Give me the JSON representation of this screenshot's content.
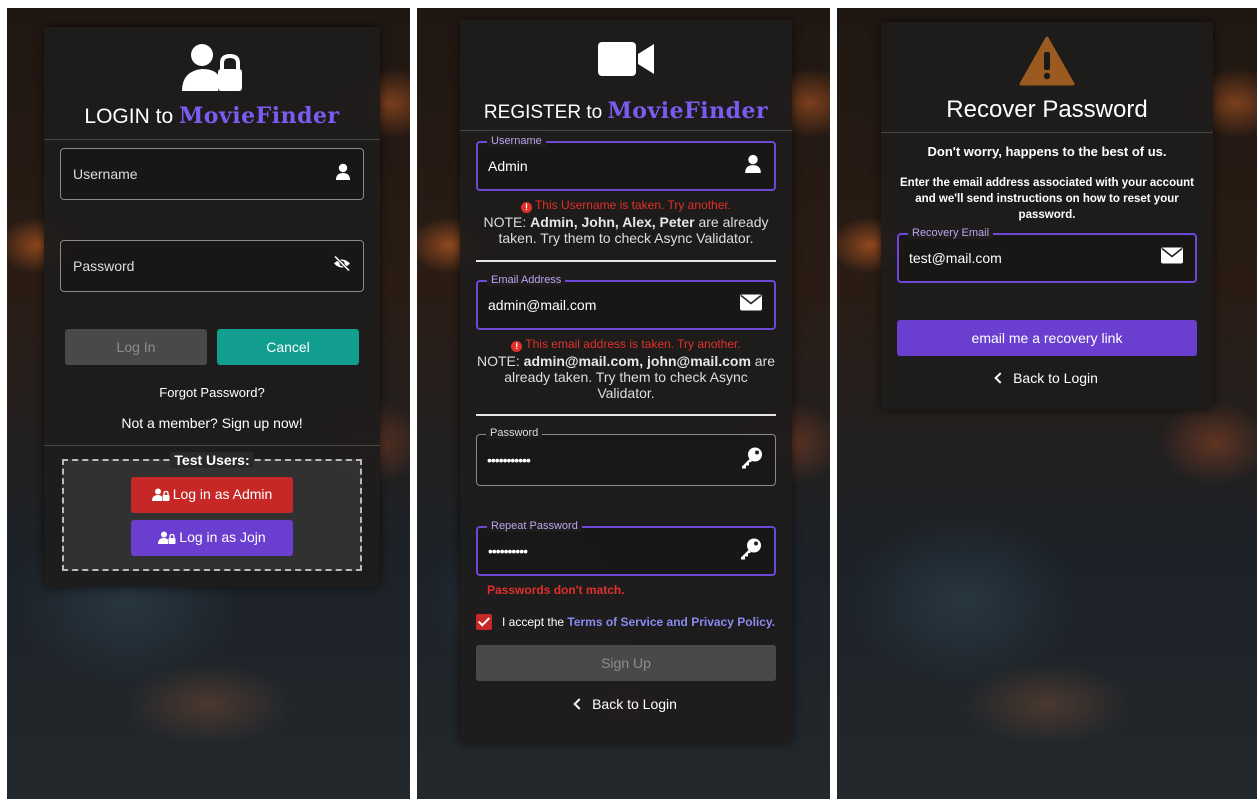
{
  "login": {
    "title_prefix": "LOGIN to ",
    "brand": "MovieFinder",
    "username_placeholder": "Username",
    "password_placeholder": "Password",
    "login_button": "Log In",
    "cancel_button": "Cancel",
    "forgot_password": "Forgot Password?",
    "signup_link": "Not a member? Sign up now!",
    "test_users_label": "Test Users:",
    "admin_button": "Log in as Admin",
    "jojn_button": "Log in as Jojn",
    "colors": {
      "cancel": "#119e8f",
      "admin": "#c62828",
      "jojn": "#6a3fd0",
      "disabled": "#4a4848"
    }
  },
  "register": {
    "title_prefix": "REGISTER to ",
    "brand": "MovieFinder",
    "username_label": "Username",
    "username_value": "Admin",
    "username_error": "This Username is taken. Try another.",
    "username_note_prefix": "NOTE: ",
    "username_note_names": "Admin, John, Alex, Peter",
    "username_note_suffix": " are already taken. Try them to check Async Validator.",
    "email_label": "Email Address",
    "email_value": "admin@mail.com",
    "email_error": "This email address is taken. Try another.",
    "email_note_prefix": "NOTE: ",
    "email_note_emails": "admin@mail.com, john@mail.com",
    "email_note_suffix": " are already taken. Try them to check Async Validator.",
    "password_label": "Password",
    "password_value": "•••••••••••",
    "repeat_label": "Repeat Password",
    "repeat_value": "••••••••••",
    "password_error": "Passwords don't match.",
    "accept_prefix": "I accept the ",
    "accept_link": "Terms of Service and Privacy Policy.",
    "signup_button": "Sign Up",
    "back_to_login": "Back to Login"
  },
  "recover": {
    "title": "Recover Password",
    "headline": "Don't worry, happens to the best of us.",
    "instructions": "Enter the email address associated with your account and we'll send instructions on how to reset your password.",
    "email_label": "Recovery Email",
    "email_value": "test@mail.com",
    "submit_button": "email me a recovery link",
    "back_to_login": "Back to Login",
    "colors": {
      "submit": "#6a3fd0",
      "warning": "#9b5a1f"
    }
  }
}
